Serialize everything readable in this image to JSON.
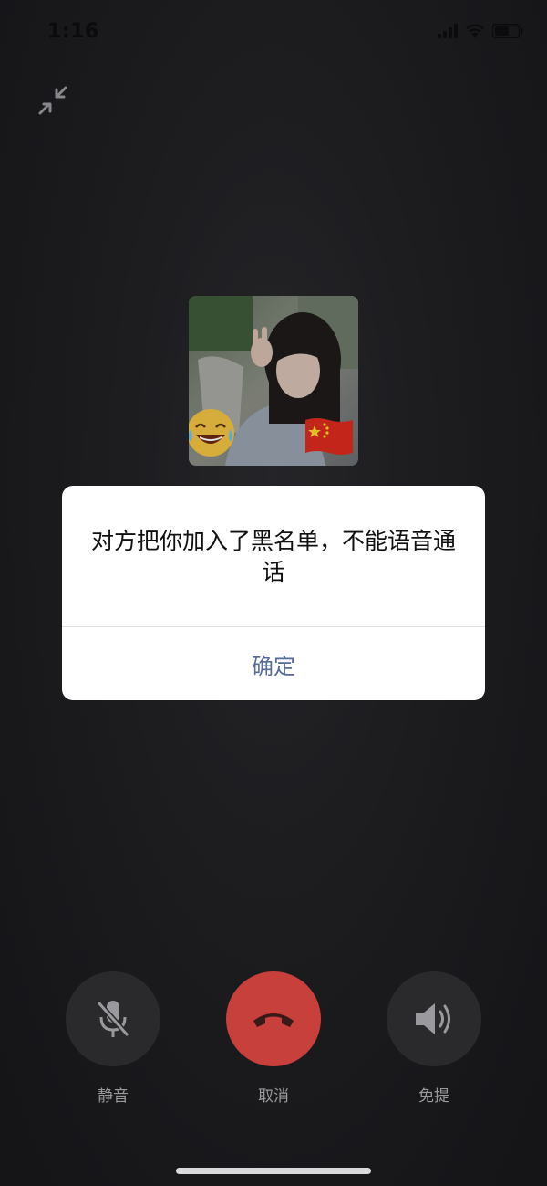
{
  "status_bar": {
    "time": "1:16"
  },
  "icons": {
    "minimize": "minimize-arrows-icon",
    "avatar_emoji_left": "laughing-tears-emoji",
    "avatar_emoji_right": "china-flag-emoji",
    "mute": "microphone-slash-icon",
    "hangup": "phone-hangup-icon",
    "speaker": "speaker-icon"
  },
  "alert": {
    "message": "对方把你加入了黑名单，不能语音通话",
    "confirm_label": "确定"
  },
  "controls": {
    "mute_label": "静音",
    "cancel_label": "取消",
    "speaker_label": "免提"
  },
  "colors": {
    "hangup": "#c8403c",
    "alert_button": "#576b95"
  }
}
